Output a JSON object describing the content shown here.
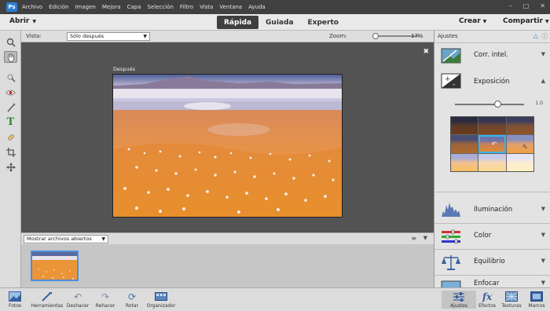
{
  "menubar": {
    "logo": "Ps",
    "items": [
      "Archivo",
      "Edición",
      "Imagen",
      "Mejora",
      "Capa",
      "Selección",
      "Filtro",
      "Vista",
      "Ventana",
      "Ayuda"
    ]
  },
  "modebar": {
    "open_label": "Abrir",
    "tabs": [
      "Rápida",
      "Guiada",
      "Experto"
    ],
    "create_label": "Crear",
    "share_label": "Compartir"
  },
  "tool_options": {
    "view_label": "Vista:",
    "view_value": "Sólo después",
    "zoom_label": "Zoom:",
    "zoom_value": "17%"
  },
  "canvas": {
    "caption": "Después"
  },
  "photo_bin": {
    "dropdown_value": "Mostrar archivos abiertos"
  },
  "panel": {
    "title": "Ajustes",
    "adjustments": [
      "Corr. intel.",
      "Exposición",
      "Iluminación",
      "Color",
      "Equilibrio",
      "Enfocar"
    ],
    "exposure_value": "1.0"
  },
  "bottom_left": [
    "Fotos",
    "Herramientas",
    "Deshacer",
    "Rehacer",
    "Rotar",
    "Organizador"
  ],
  "bottom_right": [
    "Ajustes",
    "Efectos",
    "Texturas",
    "Marcos"
  ],
  "colors": {
    "accent": "#2c7fd2",
    "active_tab": "#3f3f3f",
    "panel_bg": "#e3e3e3"
  }
}
